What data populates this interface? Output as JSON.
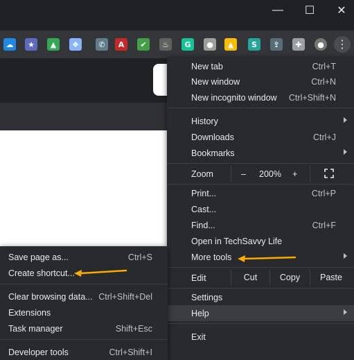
{
  "window": {
    "minimize": "—",
    "maximize": "☐",
    "close": "✕"
  },
  "extensions": [
    {
      "name": "onedrive-icon",
      "glyph": "☁",
      "color": "#1e88e5"
    },
    {
      "name": "bookmark-star-icon",
      "glyph": "★",
      "color": "#5c6bc0"
    },
    {
      "name": "google-drive-icon",
      "glyph": "▲",
      "color": "#34a853"
    },
    {
      "name": "dropbox-icon",
      "glyph": "❖",
      "color": "#8ab4f8"
    },
    {
      "name": "phone-icon",
      "glyph": "✆",
      "color": "#607d8b"
    },
    {
      "name": "pdf-icon",
      "glyph": "A",
      "color": "#c62828"
    },
    {
      "name": "checkmark-icon",
      "glyph": "✔",
      "color": "#43a047"
    },
    {
      "name": "flame-icon",
      "glyph": "♨",
      "color": "#616161"
    },
    {
      "name": "grammarly-icon",
      "glyph": "G",
      "color": "#15c39a"
    },
    {
      "name": "circle-icon",
      "glyph": "●",
      "color": "#9e9e9e"
    },
    {
      "name": "drive-icon",
      "glyph": "▲",
      "color": "#fbbc04"
    },
    {
      "name": "s-app-icon",
      "glyph": "S",
      "color": "#26a69a"
    },
    {
      "name": "upload-icon",
      "glyph": "⇪",
      "color": "#546e7a"
    },
    {
      "name": "puzzle-icon",
      "glyph": "✚",
      "color": "#9aa0a6"
    },
    {
      "name": "profile-avatar-icon",
      "glyph": "●",
      "color": "#757575"
    }
  ],
  "main_menu": {
    "new_tab": {
      "label": "New tab",
      "shortcut": "Ctrl+T"
    },
    "new_window": {
      "label": "New window",
      "shortcut": "Ctrl+N"
    },
    "new_incognito": {
      "label": "New incognito window",
      "shortcut": "Ctrl+Shift+N"
    },
    "history": {
      "label": "History"
    },
    "downloads": {
      "label": "Downloads",
      "shortcut": "Ctrl+J"
    },
    "bookmarks": {
      "label": "Bookmarks"
    },
    "zoom": {
      "label": "Zoom",
      "minus": "–",
      "value": "200%",
      "plus": "+"
    },
    "print": {
      "label": "Print...",
      "shortcut": "Ctrl+P"
    },
    "cast": {
      "label": "Cast..."
    },
    "find": {
      "label": "Find...",
      "shortcut": "Ctrl+F"
    },
    "open_in": {
      "label": "Open in TechSavvy Life"
    },
    "more_tools": {
      "label": "More tools"
    },
    "edit": {
      "label": "Edit",
      "cut": "Cut",
      "copy": "Copy",
      "paste": "Paste"
    },
    "settings": {
      "label": "Settings"
    },
    "help": {
      "label": "Help"
    },
    "exit": {
      "label": "Exit"
    }
  },
  "submenu": {
    "save_page": {
      "label": "Save page as...",
      "shortcut": "Ctrl+S"
    },
    "create_shortcut": {
      "label": "Create shortcut..."
    },
    "clear_data": {
      "label": "Clear browsing data...",
      "shortcut": "Ctrl+Shift+Del"
    },
    "extensions": {
      "label": "Extensions"
    },
    "task_manager": {
      "label": "Task manager",
      "shortcut": "Shift+Esc"
    },
    "developer_tools": {
      "label": "Developer tools",
      "shortcut": "Ctrl+Shift+I"
    }
  },
  "colors": {
    "arrow": "#f9ab00"
  }
}
